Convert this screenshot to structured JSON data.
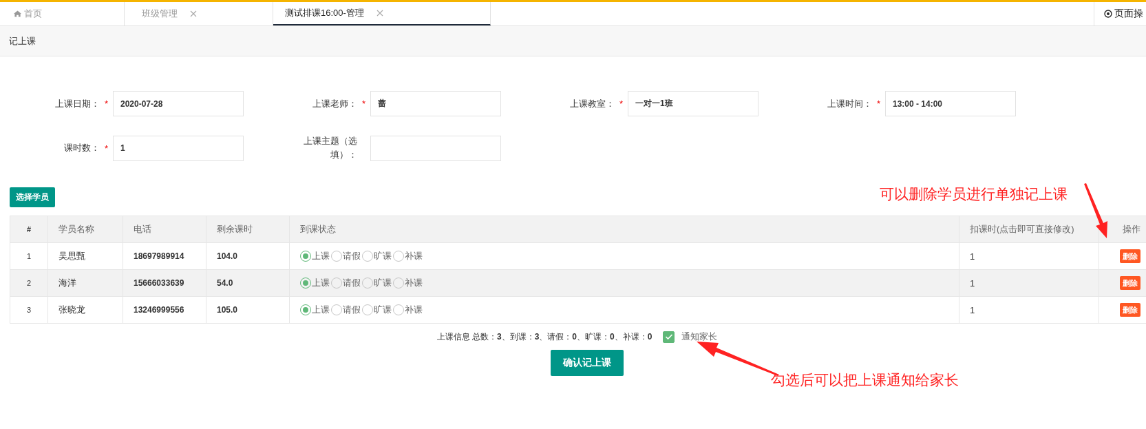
{
  "tabs": [
    {
      "label": "首页",
      "kind": "home",
      "selected": false,
      "closable": false
    },
    {
      "label": "班级管理",
      "kind": "page",
      "selected": false,
      "closable": true
    },
    {
      "label": "测试排课16:00-管理",
      "kind": "page",
      "selected": true,
      "closable": true
    }
  ],
  "page_actions": "页面操",
  "page_title": "记上课",
  "form": [
    [
      {
        "label": "上课日期：",
        "required_mark": "*",
        "value": "2020-07-28"
      },
      {
        "label": "上课老师：",
        "required_mark": "*",
        "value": "蔷"
      },
      {
        "label": "上课教室：",
        "required_mark": "*",
        "value": "一对一1班"
      },
      {
        "label": "上课时间：",
        "required_mark": "*",
        "value": "13:00 - 14:00"
      }
    ],
    [
      {
        "label": "课时数：",
        "required_mark": "*",
        "value": "1"
      },
      {
        "label": "上课主题（选填）："
      }
    ]
  ],
  "select_button": "选择学员",
  "table": {
    "columns": [
      "#",
      "学员名称",
      "电话",
      "剩余课时",
      "到课状态",
      "扣课时(点击即可直接修改)",
      "操作"
    ],
    "rows": [
      {
        "index": "1",
        "name": "吴思甄",
        "phone": "18697989914",
        "remaining": "104.0",
        "attendance": [
          {
            "label": "上课",
            "selected": true
          },
          {
            "label": "请假",
            "selected": false
          },
          {
            "label": "旷课",
            "selected": false
          },
          {
            "label": "补课",
            "selected": false
          }
        ],
        "deduct": "1",
        "action": "删除"
      },
      {
        "index": "2",
        "name": "海洋",
        "phone": "15666033639",
        "remaining": "54.0",
        "attendance": [
          {
            "label": "上课",
            "selected": true
          },
          {
            "label": "请假",
            "selected": false
          },
          {
            "label": "旷课",
            "selected": false
          },
          {
            "label": "补课",
            "selected": false
          }
        ],
        "deduct": "1",
        "action": "删除"
      },
      {
        "index": "3",
        "name": "张晓龙",
        "phone": "13246999556",
        "remaining": "105.0",
        "attendance": [
          {
            "label": "上课",
            "selected": true
          },
          {
            "label": "请假",
            "selected": false
          },
          {
            "label": "旷课",
            "selected": false
          },
          {
            "label": "补课",
            "selected": false
          }
        ],
        "deduct": "1",
        "action": "删除"
      }
    ]
  },
  "summary": "上课信息 总数：**3**、到课：**3**、请假：**0**、旷课：**0**、补课：**0**",
  "notify": {
    "label": "通知家长",
    "checked": true
  },
  "confirm_button": "确认记上课",
  "annotations": [
    {
      "text": "可以删除学员进行单独记上课",
      "kind": "delete"
    },
    {
      "text": "勾选后可以把上课通知给家长",
      "kind": "notify"
    }
  ]
}
